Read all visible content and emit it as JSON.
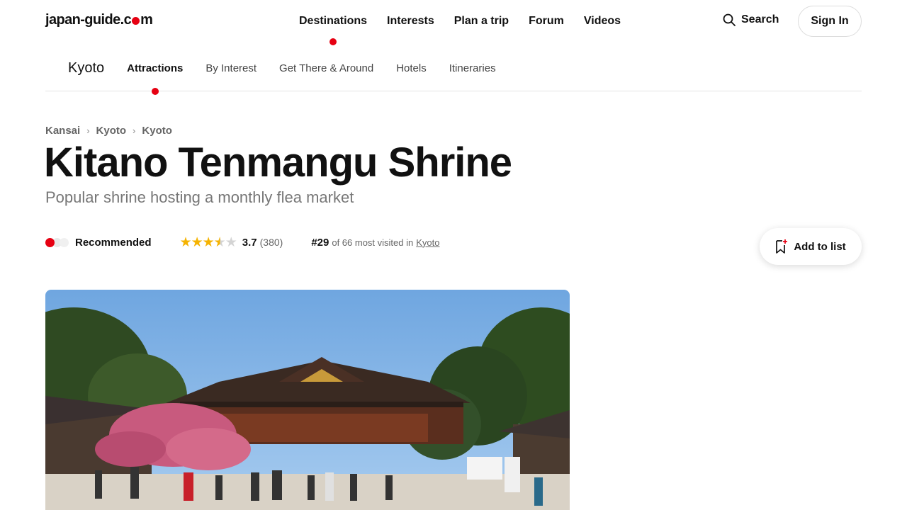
{
  "header": {
    "logo_left": "japan-guide.c",
    "logo_right": "m",
    "nav": [
      {
        "label": "Destinations"
      },
      {
        "label": "Interests"
      },
      {
        "label": "Plan a trip"
      },
      {
        "label": "Forum"
      },
      {
        "label": "Videos"
      }
    ],
    "search_label": "Search",
    "signin_label": "Sign In"
  },
  "subnav": {
    "city": "Kyoto",
    "items": [
      {
        "label": "Attractions"
      },
      {
        "label": "By Interest"
      },
      {
        "label": "Get There & Around"
      },
      {
        "label": "Hotels"
      },
      {
        "label": "Itineraries"
      }
    ]
  },
  "breadcrumb": [
    "Kansai",
    "Kyoto",
    "Kyoto"
  ],
  "breadcrumb_separator": "›",
  "page": {
    "title": "Kitano Tenmangu Shrine",
    "subtitle": "Popular shrine hosting a monthly flea market"
  },
  "meta": {
    "recommendation_label": "Recommended",
    "recommendation_level": 1,
    "recommendation_max": 3,
    "rating_value": "3.7",
    "rating_count": "(380)",
    "rank": "#29",
    "rank_text": "of 66 most visited in",
    "rank_link": "Kyoto"
  },
  "actions": {
    "add_to_list_label": "Add to list"
  },
  "hero": {
    "image": "kitano-tenmangu-shrine-photo"
  },
  "colors": {
    "accent": "#e60012",
    "star": "#f5b301",
    "sky": "#7fb0e3"
  }
}
